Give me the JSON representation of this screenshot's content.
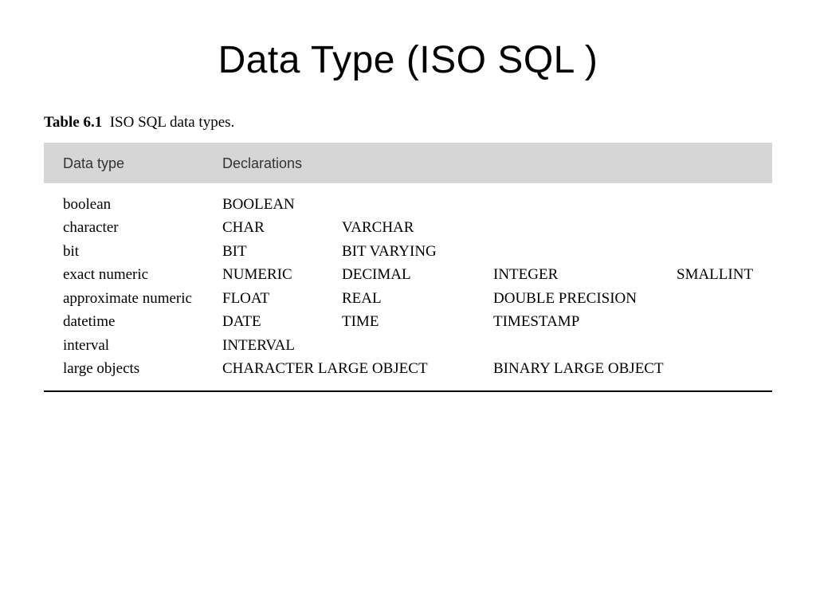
{
  "title": "Data Type (ISO SQL )",
  "caption": {
    "label": "Table 6.1",
    "text": "ISO SQL data types."
  },
  "headers": {
    "col1": "Data type",
    "col2": "Declarations"
  },
  "rows": {
    "r0": {
      "type": "boolean",
      "d1": "BOOLEAN",
      "d2": "",
      "d3": "",
      "d4": ""
    },
    "r1": {
      "type": "character",
      "d1": "CHAR",
      "d2": "VARCHAR",
      "d3": "",
      "d4": ""
    },
    "r2": {
      "type": "bit",
      "d1": "BIT",
      "d2": "BIT VARYING",
      "d3": "",
      "d4": ""
    },
    "r3": {
      "type": "exact numeric",
      "d1": "NUMERIC",
      "d2": "DECIMAL",
      "d3": "INTEGER",
      "d4": "SMALLINT"
    },
    "r4": {
      "type": "approximate numeric",
      "d1": "FLOAT",
      "d2": "REAL",
      "d3": "DOUBLE PRECISION",
      "d4": ""
    },
    "r5": {
      "type": "datetime",
      "d1": "DATE",
      "d2": "TIME",
      "d3": "TIMESTAMP",
      "d4": ""
    },
    "r6": {
      "type": "interval",
      "d1": "INTERVAL",
      "d2": "",
      "d3": "",
      "d4": ""
    },
    "r7": {
      "type": "large objects",
      "d1w": "CHARACTER LARGE OBJECT",
      "d3": "BINARY LARGE OBJECT"
    }
  }
}
